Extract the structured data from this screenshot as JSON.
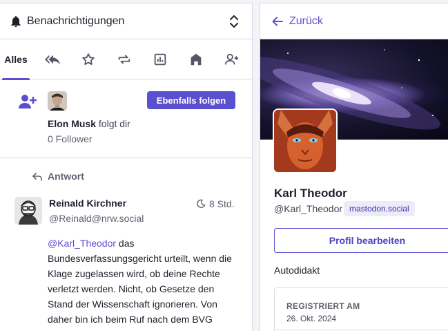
{
  "left_column": {
    "title": "Benachrichtigungen",
    "tabs": [
      {
        "label": "Alles",
        "active": true
      },
      {
        "icon": "reply-all-icon"
      },
      {
        "icon": "star-icon"
      },
      {
        "icon": "boost-icon"
      },
      {
        "icon": "poll-icon"
      },
      {
        "icon": "home-icon"
      },
      {
        "icon": "person-add-icon"
      }
    ],
    "follow_notification": {
      "follow_button": "Ebenfalls folgen",
      "name": "Elon Musk",
      "action": "folgt dir",
      "followers": "0 Follower"
    },
    "reply_notification": {
      "label": "Antwort",
      "author_name": "Reinald Kirchner",
      "author_handle": "@Reinald@nrw.social",
      "time": "8 Std.",
      "mention": "@Karl_Theodor",
      "body_text": " das Bundesverfassungsgericht urteilt, wenn die Klage zugelassen wird, ob deine Rechte verletzt werden. Nicht, ob Gesetze den Stand der Wissenschaft ignorieren. Von daher bin ich  beim Ruf nach dem BVG immer sehr"
    }
  },
  "right_column": {
    "back_label": "Zurück",
    "profile": {
      "display_name": "Karl Theodor",
      "handle": "@Karl_Theodor",
      "domain": "mastodon.social",
      "edit_button": "Profil bearbeiten",
      "bio": "Autodidakt",
      "field_label": "REGISTRIERT AM",
      "field_value": "26. Okt. 2024"
    }
  },
  "colors": {
    "accent": "#5a4fcf",
    "border": "#d9d9e3",
    "muted_text": "#606070"
  }
}
